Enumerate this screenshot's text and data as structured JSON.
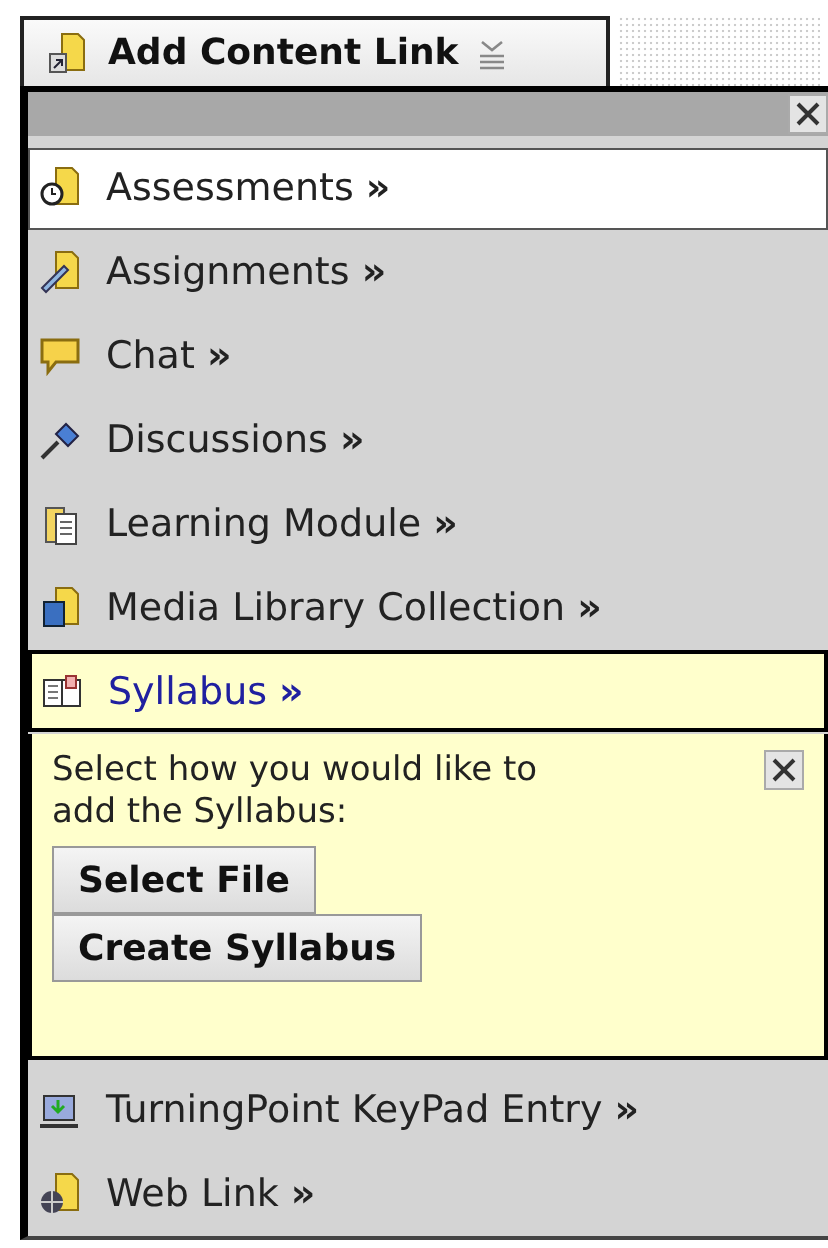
{
  "header_button": {
    "label": "Add Content Link"
  },
  "items": [
    {
      "label": "Assessments **»**",
      "highlighted": true,
      "selected": false,
      "expanded": false
    },
    {
      "label": "Assignments **»**",
      "highlighted": false,
      "selected": false,
      "expanded": false
    },
    {
      "label": "Chat **»**",
      "highlighted": false,
      "selected": false,
      "expanded": false
    },
    {
      "label": "Discussions **»**",
      "highlighted": false,
      "selected": false,
      "expanded": false
    },
    {
      "label": "Learning Module **»**",
      "highlighted": false,
      "selected": false,
      "expanded": false
    },
    {
      "label": "Media Library Collection **»**",
      "highlighted": false,
      "selected": false,
      "expanded": false
    },
    {
      "label": "Syllabus **»**",
      "highlighted": false,
      "selected": true,
      "expanded": true
    },
    {
      "label": "TurningPoint KeyPad Entry **»**",
      "highlighted": false,
      "selected": false,
      "expanded": false
    },
    {
      "label": "Web Link **»**",
      "highlighted": false,
      "selected": false,
      "expanded": false
    }
  ],
  "prompt": {
    "text": "Select how you would like to add the Syllabus:",
    "buttons": [
      "Select File",
      "Create Syllabus"
    ]
  }
}
